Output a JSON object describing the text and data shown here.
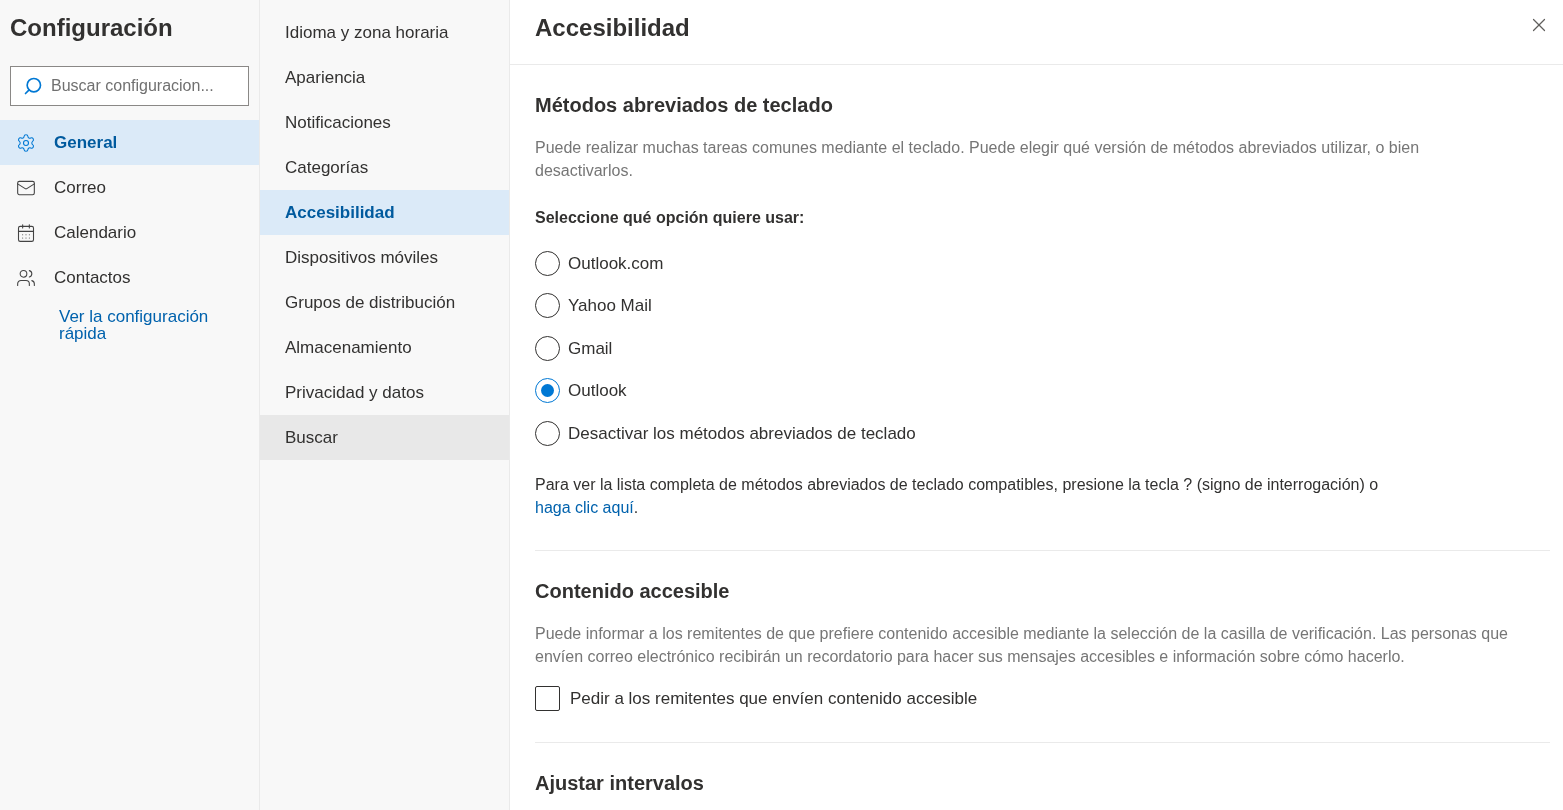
{
  "sidebar": {
    "title": "Configuración",
    "search": {
      "placeholder": "Buscar configuracion..."
    },
    "items": [
      {
        "kind": "gear",
        "label": "General",
        "selected": true
      },
      {
        "kind": "mail",
        "label": "Correo",
        "selected": false
      },
      {
        "kind": "calendar",
        "label": "Calendario",
        "selected": false
      },
      {
        "kind": "people",
        "label": "Contactos",
        "selected": false
      }
    ],
    "quick_link": "Ver la configuración rápida"
  },
  "subnav": {
    "items": [
      {
        "label": "Idioma y zona horaria",
        "selected": false,
        "hovered": false
      },
      {
        "label": "Apariencia",
        "selected": false,
        "hovered": false
      },
      {
        "label": "Notificaciones",
        "selected": false,
        "hovered": false
      },
      {
        "label": "Categorías",
        "selected": false,
        "hovered": false
      },
      {
        "label": "Accesibilidad",
        "selected": true,
        "hovered": false
      },
      {
        "label": "Dispositivos móviles",
        "selected": false,
        "hovered": false
      },
      {
        "label": "Grupos de distribución",
        "selected": false,
        "hovered": false
      },
      {
        "label": "Almacenamiento",
        "selected": false,
        "hovered": false
      },
      {
        "label": "Privacidad y datos",
        "selected": false,
        "hovered": false
      },
      {
        "label": "Buscar",
        "selected": false,
        "hovered": true
      }
    ]
  },
  "panel": {
    "title": "Accesibilidad",
    "keyboard": {
      "heading": "Métodos abreviados de teclado",
      "description": "Puede realizar muchas tareas comunes mediante el teclado. Puede elegir qué versión de métodos abreviados utilizar, o bien desactivarlos.",
      "prompt": "Seleccione qué opción quiere usar:",
      "options": [
        {
          "label": "Outlook.com",
          "selected": false
        },
        {
          "label": "Yahoo Mail",
          "selected": false
        },
        {
          "label": "Gmail",
          "selected": false
        },
        {
          "label": "Outlook",
          "selected": true
        },
        {
          "label": "Desactivar los métodos abreviados de teclado",
          "selected": false
        }
      ],
      "help_text": "Para ver la lista completa de métodos abreviados de teclado compatibles, presione la tecla ? (signo de interrogación) o",
      "help_link": "haga clic aquí",
      "help_suffix": "."
    },
    "accessible": {
      "heading": "Contenido accesible",
      "description": "Puede informar a los remitentes de que prefiere contenido accesible mediante la selección de la casilla de verificación. Las personas que envíen correo electrónico recibirán un recordatorio para hacer sus mensajes accesibles e información sobre cómo hacerlo.",
      "checkbox": {
        "label": "Pedir a los remitentes que envíen contenido accesible",
        "checked": false
      }
    },
    "intervals": {
      "heading": "Ajustar intervalos"
    }
  }
}
